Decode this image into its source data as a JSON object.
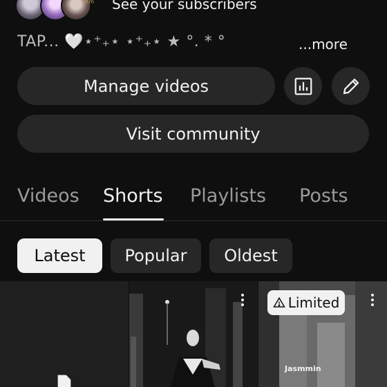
{
  "subscribers": {
    "text": "See your subscribers",
    "avatar_tag": "dtm"
  },
  "description": {
    "text": "TAP... 🤍⋆⁺₊⋆  ⋆⁺₊⋆ ★ °. *          °",
    "more_label": "...more"
  },
  "actions": {
    "manage_label": "Manage videos",
    "visit_label": "Visit community",
    "stats_icon": "analytics-icon",
    "edit_icon": "pencil-icon"
  },
  "tabs": [
    {
      "label": "Videos",
      "active": false
    },
    {
      "label": "Shorts",
      "active": true
    },
    {
      "label": "Playlists",
      "active": false
    },
    {
      "label": "Posts",
      "active": false
    }
  ],
  "chips": [
    {
      "label": "Latest",
      "active": true
    },
    {
      "label": "Popular",
      "active": false
    },
    {
      "label": "Oldest",
      "active": false
    }
  ],
  "shorts": [
    {
      "icon": "draft-file-icon"
    },
    {
      "badge": ""
    },
    {
      "badge": "Limited",
      "badge_icon": "warning-icon",
      "overlay_text": "Jasmmin"
    }
  ],
  "colors": {
    "background": "#0f0f0f",
    "surface": "#272727",
    "text": "#f1f1f1",
    "muted": "#9a9a9a"
  }
}
